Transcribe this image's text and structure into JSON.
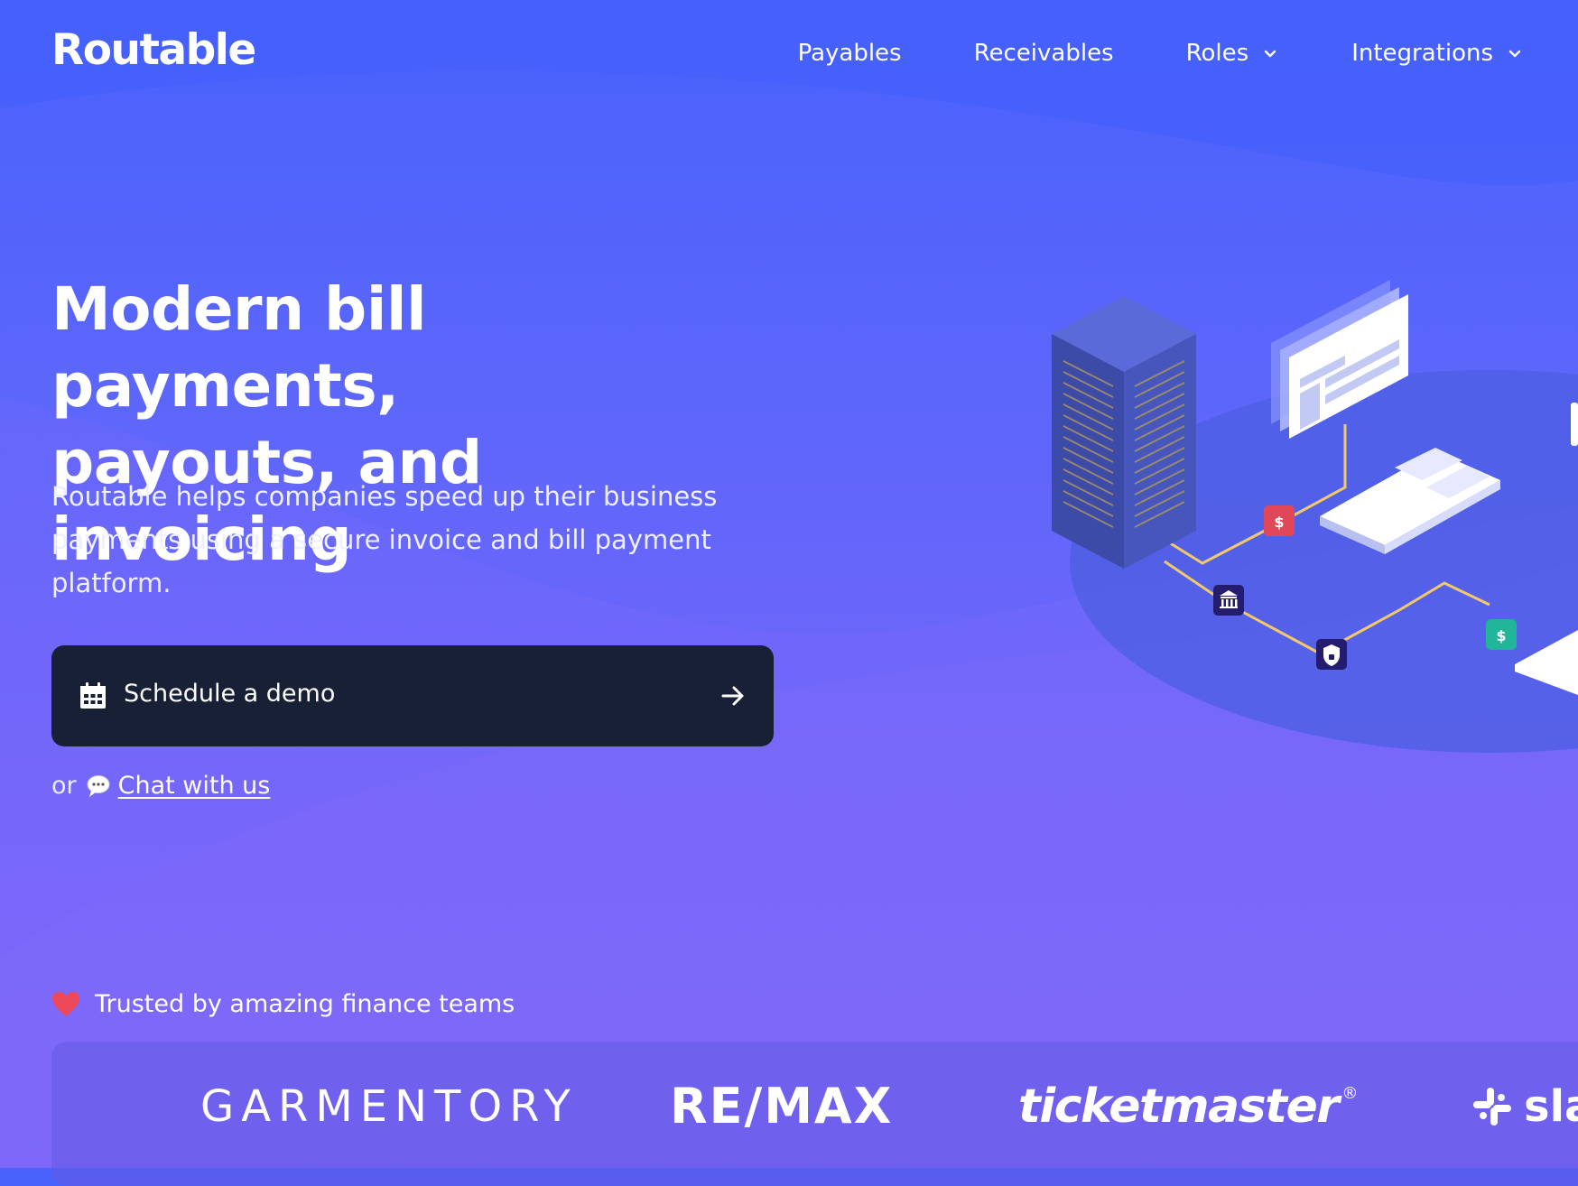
{
  "brand": {
    "name": "Routable"
  },
  "nav": {
    "items": [
      {
        "label": "Payables"
      },
      {
        "label": "Receivables"
      },
      {
        "label": "Roles"
      },
      {
        "label": "Integrations"
      }
    ]
  },
  "hero": {
    "title_line1": "Modern bill payments,",
    "title_line2": "payouts, and invoicing",
    "subtitle": "Routable helps companies speed up their business payments using a secure invoice and bill payment platform.",
    "cta_label": "Schedule a demo",
    "or_text": "or",
    "chat_link": "Chat with us"
  },
  "trusted": {
    "label": "Trusted by amazing finance teams",
    "logos": [
      "GARMENTORY",
      "RE/MAX",
      "ticketmaster",
      "sla"
    ]
  },
  "icons": {
    "calendar": "calendar-icon",
    "arrow": "arrow-right-icon",
    "chat": "chat-bubble-icon",
    "heart": "heart-icon",
    "chevron": "chevron-down-icon"
  },
  "colors": {
    "background_top": "#4862fb",
    "background_bottom": "#7e66f8",
    "cta_bg": "#182036",
    "heart": "#ec4a5b",
    "dollar_red": "#e0485a",
    "dollar_green": "#21b59a",
    "node_dark": "#241c6e"
  }
}
